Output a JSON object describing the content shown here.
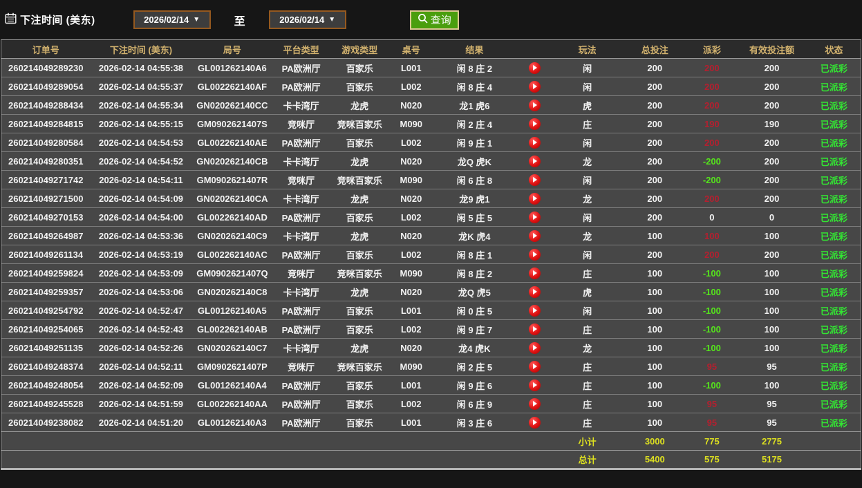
{
  "filters": {
    "label": "下注时间 (美东)",
    "date_from": "2026/02/14",
    "date_to": "2026/02/14",
    "to_label": "至",
    "search_button_label": "查询"
  },
  "icons": {
    "calendar": "calendar-icon",
    "search": "search-icon",
    "dropdown_arrow": "▼",
    "play": "play-icon"
  },
  "colors": {
    "header_text": "#d2b26e",
    "payout_positive": "#b51f2f",
    "payout_negative": "#55e41c",
    "status_green": "#33e433",
    "footer_yellow": "#dde020",
    "button_green": "#4a9e0e",
    "date_border_brown": "#95591f"
  },
  "table": {
    "headers": [
      "订单号",
      "下注时间 (美东)",
      "局号",
      "平台类型",
      "游戏类型",
      "桌号",
      "结果",
      "",
      "玩法",
      "总投注",
      "派彩",
      "有效投注额",
      "状态"
    ],
    "rows": [
      {
        "order": "260214049289230",
        "time": "2026-02-14 04:55:38",
        "round": "GL001262140A6",
        "platform": "PA欧洲厅",
        "game": "百家乐",
        "table": "L001",
        "result": "闲 8 庄 2",
        "bet_type": "闲",
        "total_bet": "200",
        "payout": "200",
        "valid_bet": "200",
        "status": "已派彩"
      },
      {
        "order": "260214049289054",
        "time": "2026-02-14 04:55:37",
        "round": "GL002262140AF",
        "platform": "PA欧洲厅",
        "game": "百家乐",
        "table": "L002",
        "result": "闲 8 庄 4",
        "bet_type": "闲",
        "total_bet": "200",
        "payout": "200",
        "valid_bet": "200",
        "status": "已派彩"
      },
      {
        "order": "260214049288434",
        "time": "2026-02-14 04:55:34",
        "round": "GN020262140CC",
        "platform": "卡卡湾厅",
        "game": "龙虎",
        "table": "N020",
        "result": "龙1 虎6",
        "bet_type": "虎",
        "total_bet": "200",
        "payout": "200",
        "valid_bet": "200",
        "status": "已派彩"
      },
      {
        "order": "260214049284815",
        "time": "2026-02-14 04:55:15",
        "round": "GM0902621407S",
        "platform": "竞咪厅",
        "game": "竞咪百家乐",
        "table": "M090",
        "result": "闲 2 庄 4",
        "bet_type": "庄",
        "total_bet": "200",
        "payout": "190",
        "valid_bet": "190",
        "status": "已派彩"
      },
      {
        "order": "260214049280584",
        "time": "2026-02-14 04:54:53",
        "round": "GL002262140AE",
        "platform": "PA欧洲厅",
        "game": "百家乐",
        "table": "L002",
        "result": "闲 9 庄 1",
        "bet_type": "闲",
        "total_bet": "200",
        "payout": "200",
        "valid_bet": "200",
        "status": "已派彩"
      },
      {
        "order": "260214049280351",
        "time": "2026-02-14 04:54:52",
        "round": "GN020262140CB",
        "platform": "卡卡湾厅",
        "game": "龙虎",
        "table": "N020",
        "result": "龙Q 虎K",
        "bet_type": "龙",
        "total_bet": "200",
        "payout": "-200",
        "valid_bet": "200",
        "status": "已派彩"
      },
      {
        "order": "260214049271742",
        "time": "2026-02-14 04:54:11",
        "round": "GM0902621407R",
        "platform": "竞咪厅",
        "game": "竞咪百家乐",
        "table": "M090",
        "result": "闲 6 庄 8",
        "bet_type": "闲",
        "total_bet": "200",
        "payout": "-200",
        "valid_bet": "200",
        "status": "已派彩"
      },
      {
        "order": "260214049271500",
        "time": "2026-02-14 04:54:09",
        "round": "GN020262140CA",
        "platform": "卡卡湾厅",
        "game": "龙虎",
        "table": "N020",
        "result": "龙9 虎1",
        "bet_type": "龙",
        "total_bet": "200",
        "payout": "200",
        "valid_bet": "200",
        "status": "已派彩"
      },
      {
        "order": "260214049270153",
        "time": "2026-02-14 04:54:00",
        "round": "GL002262140AD",
        "platform": "PA欧洲厅",
        "game": "百家乐",
        "table": "L002",
        "result": "闲 5 庄 5",
        "bet_type": "闲",
        "total_bet": "200",
        "payout": "0",
        "valid_bet": "0",
        "status": "已派彩"
      },
      {
        "order": "260214049264987",
        "time": "2026-02-14 04:53:36",
        "round": "GN020262140C9",
        "platform": "卡卡湾厅",
        "game": "龙虎",
        "table": "N020",
        "result": "龙K 虎4",
        "bet_type": "龙",
        "total_bet": "100",
        "payout": "100",
        "valid_bet": "100",
        "status": "已派彩"
      },
      {
        "order": "260214049261134",
        "time": "2026-02-14 04:53:19",
        "round": "GL002262140AC",
        "platform": "PA欧洲厅",
        "game": "百家乐",
        "table": "L002",
        "result": "闲 8 庄 1",
        "bet_type": "闲",
        "total_bet": "200",
        "payout": "200",
        "valid_bet": "200",
        "status": "已派彩"
      },
      {
        "order": "260214049259824",
        "time": "2026-02-14 04:53:09",
        "round": "GM0902621407Q",
        "platform": "竞咪厅",
        "game": "竞咪百家乐",
        "table": "M090",
        "result": "闲 8 庄 2",
        "bet_type": "庄",
        "total_bet": "100",
        "payout": "-100",
        "valid_bet": "100",
        "status": "已派彩"
      },
      {
        "order": "260214049259357",
        "time": "2026-02-14 04:53:06",
        "round": "GN020262140C8",
        "platform": "卡卡湾厅",
        "game": "龙虎",
        "table": "N020",
        "result": "龙Q 虎5",
        "bet_type": "虎",
        "total_bet": "100",
        "payout": "-100",
        "valid_bet": "100",
        "status": "已派彩"
      },
      {
        "order": "260214049254792",
        "time": "2026-02-14 04:52:47",
        "round": "GL001262140A5",
        "platform": "PA欧洲厅",
        "game": "百家乐",
        "table": "L001",
        "result": "闲 0 庄 5",
        "bet_type": "闲",
        "total_bet": "100",
        "payout": "-100",
        "valid_bet": "100",
        "status": "已派彩"
      },
      {
        "order": "260214049254065",
        "time": "2026-02-14 04:52:43",
        "round": "GL002262140AB",
        "platform": "PA欧洲厅",
        "game": "百家乐",
        "table": "L002",
        "result": "闲 9 庄 7",
        "bet_type": "庄",
        "total_bet": "100",
        "payout": "-100",
        "valid_bet": "100",
        "status": "已派彩"
      },
      {
        "order": "260214049251135",
        "time": "2026-02-14 04:52:26",
        "round": "GN020262140C7",
        "platform": "卡卡湾厅",
        "game": "龙虎",
        "table": "N020",
        "result": "龙4 虎K",
        "bet_type": "龙",
        "total_bet": "100",
        "payout": "-100",
        "valid_bet": "100",
        "status": "已派彩"
      },
      {
        "order": "260214049248374",
        "time": "2026-02-14 04:52:11",
        "round": "GM0902621407P",
        "platform": "竞咪厅",
        "game": "竞咪百家乐",
        "table": "M090",
        "result": "闲 2 庄 5",
        "bet_type": "庄",
        "total_bet": "100",
        "payout": "95",
        "valid_bet": "95",
        "status": "已派彩"
      },
      {
        "order": "260214049248054",
        "time": "2026-02-14 04:52:09",
        "round": "GL001262140A4",
        "platform": "PA欧洲厅",
        "game": "百家乐",
        "table": "L001",
        "result": "闲 9 庄 6",
        "bet_type": "庄",
        "total_bet": "100",
        "payout": "-100",
        "valid_bet": "100",
        "status": "已派彩"
      },
      {
        "order": "260214049245528",
        "time": "2026-02-14 04:51:59",
        "round": "GL002262140AA",
        "platform": "PA欧洲厅",
        "game": "百家乐",
        "table": "L002",
        "result": "闲 6 庄 9",
        "bet_type": "庄",
        "total_bet": "100",
        "payout": "95",
        "valid_bet": "95",
        "status": "已派彩"
      },
      {
        "order": "260214049238082",
        "time": "2026-02-14 04:51:20",
        "round": "GL001262140A3",
        "platform": "PA欧洲厅",
        "game": "百家乐",
        "table": "L001",
        "result": "闲 3 庄 6",
        "bet_type": "庄",
        "total_bet": "100",
        "payout": "95",
        "valid_bet": "95",
        "status": "已派彩"
      }
    ],
    "subtotal": {
      "label": "小计",
      "total_bet": "3000",
      "payout": "775",
      "valid_bet": "2775"
    },
    "total": {
      "label": "总计",
      "total_bet": "5400",
      "payout": "575",
      "valid_bet": "5175"
    }
  }
}
